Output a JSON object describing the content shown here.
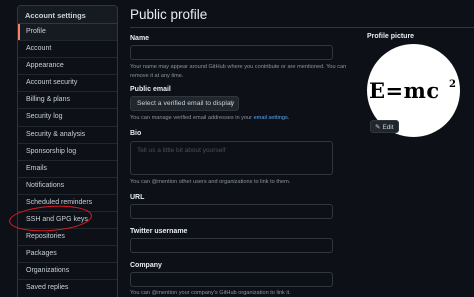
{
  "sidebar": {
    "header": "Account settings",
    "items": [
      {
        "label": "Profile"
      },
      {
        "label": "Account"
      },
      {
        "label": "Appearance"
      },
      {
        "label": "Account security"
      },
      {
        "label": "Billing & plans"
      },
      {
        "label": "Security log"
      },
      {
        "label": "Security & analysis"
      },
      {
        "label": "Sponsorship log"
      },
      {
        "label": "Emails"
      },
      {
        "label": "Notifications"
      },
      {
        "label": "Scheduled reminders"
      },
      {
        "label": "SSH and GPG keys"
      },
      {
        "label": "Repositories"
      },
      {
        "label": "Packages"
      },
      {
        "label": "Organizations"
      },
      {
        "label": "Saved replies"
      }
    ]
  },
  "page": {
    "title": "Public profile"
  },
  "form": {
    "name_label": "Name",
    "name_help_1": "Your name may appear around GitHub where you contribute or are mentioned. You can",
    "name_help_2": "remove it at any time.",
    "email_label": "Public email",
    "email_select": "Select a verified email to display",
    "email_help_prefix": "You can manage verified email addresses in your ",
    "email_help_link": "email settings",
    "email_help_suffix": ".",
    "bio_label": "Bio",
    "bio_placeholder": "Tell us a little bit about yourself",
    "bio_help": "You can @mention other users and organizations to link to them.",
    "url_label": "URL",
    "twitter_label": "Twitter username",
    "company_label": "Company",
    "company_help": "You can @mention your company's GitHub organization to link it."
  },
  "profile_picture": {
    "label": "Profile picture",
    "image_text": "E=mc",
    "image_superscript": "2",
    "edit_label": "Edit",
    "edit_icon": "pencil-icon"
  },
  "colors": {
    "accent": "#f78166",
    "annotation": "#e01b24",
    "link": "#58a6ff"
  }
}
